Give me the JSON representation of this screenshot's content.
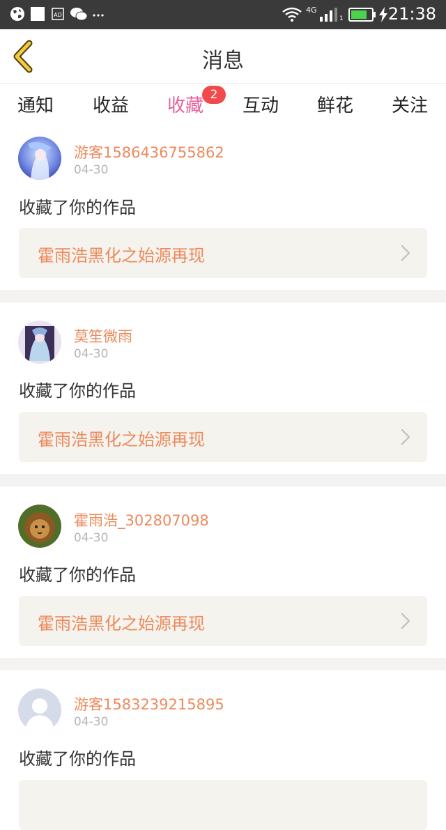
{
  "status_bar": {
    "time": "21:38",
    "network": "4G",
    "sim_slot": "1",
    "icons": [
      "globe-icon",
      "white-square-icon",
      "ad-icon",
      "wechat-icon",
      "more-dots-icon",
      "wifi-icon",
      "signal-icon",
      "battery-icon",
      "charging-icon"
    ]
  },
  "header": {
    "title": "消息",
    "back_icon": "chevron-left-icon"
  },
  "tabs": {
    "items": [
      {
        "label": "通知",
        "active": false
      },
      {
        "label": "收益",
        "active": false
      },
      {
        "label": "收藏",
        "active": true,
        "badge": "2"
      },
      {
        "label": "互动",
        "active": false
      },
      {
        "label": "鲜花",
        "active": false
      },
      {
        "label": "关注",
        "active": false
      }
    ]
  },
  "feed": {
    "items": [
      {
        "username": "游客1586436755862",
        "date": "04-30",
        "message": "收藏了你的作品",
        "work_title": "霍雨浩黑化之始源再现",
        "avatar": "anime-avatar-blue"
      },
      {
        "username": "莫笙微雨",
        "date": "04-30",
        "message": "收藏了你的作品",
        "work_title": "霍雨浩黑化之始源再现",
        "avatar": "anime-avatar-purple"
      },
      {
        "username": "霍雨浩_302807098",
        "date": "04-30",
        "message": "收藏了你的作品",
        "work_title": "霍雨浩黑化之始源再现",
        "avatar": "lion-avatar"
      },
      {
        "username": "游客1583239215895",
        "date": "04-30",
        "message": "收藏了你的作品",
        "work_title": "",
        "avatar": "default-user-avatar"
      }
    ]
  },
  "colors": {
    "accent": "#e8609a",
    "username": "#ec8a5c",
    "badge": "#f24a4a",
    "work_bg": "#f5f3ee",
    "statusbar_bg": "#3a3a3a"
  }
}
